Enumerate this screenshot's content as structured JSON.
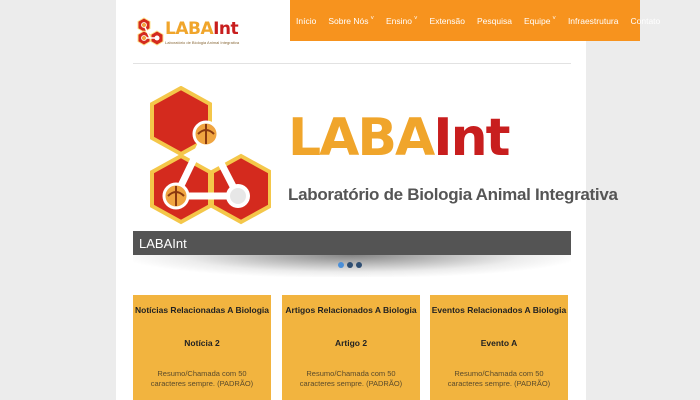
{
  "header": {
    "logo_title_main": "LABA",
    "logo_title_accent": "Int",
    "logo_subtitle": "Laboratório de Biologia Animal Integrativa"
  },
  "nav": {
    "items": [
      {
        "label": "Início",
        "has_dropdown": false
      },
      {
        "label": "Sobre Nós",
        "has_dropdown": true
      },
      {
        "label": "Ensino",
        "has_dropdown": true
      },
      {
        "label": "Extensão",
        "has_dropdown": false
      },
      {
        "label": "Pesquisa",
        "has_dropdown": false
      },
      {
        "label": "Equipe",
        "has_dropdown": true
      },
      {
        "label": "Infraestrutura",
        "has_dropdown": false
      },
      {
        "label": "Contato",
        "has_dropdown": false
      }
    ],
    "caret_glyph": "˅"
  },
  "slider": {
    "title_main": "LABA",
    "title_accent": "Int",
    "subtitle": "Laboratório de Biologia Animal Integrativa",
    "caption": "LABAInt",
    "slide_count": 3,
    "active_slide": 1
  },
  "cards": [
    {
      "heading": "Notícias Relacionadas A Biologia",
      "item_title": "Notícia 2",
      "summary": "Resumo/Chamada com 50 caracteres sempre. (PADRÃO)"
    },
    {
      "heading": "Artigos Relacionados A Biologia",
      "item_title": "Artigo 2",
      "summary": "Resumo/Chamada com 50 caracteres sempre. (PADRÃO)"
    },
    {
      "heading": "Eventos Relacionados A Biologia",
      "item_title": "Evento A",
      "summary": "Resumo/Chamada com 50 caracteres sempre. (PADRÃO)"
    }
  ],
  "colors": {
    "nav_bg": "#f7931e",
    "logo_orange": "#f0a52b",
    "logo_red": "#c81e1e",
    "card_bg": "#f2b43f",
    "caption_bg": "#545454"
  }
}
